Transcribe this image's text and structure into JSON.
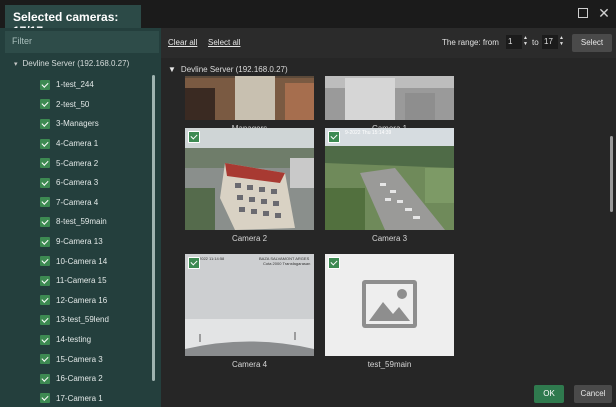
{
  "window": {
    "title": "Selected cameras: 17/17",
    "maximize_icon": "maximize-icon",
    "close_icon": "close-icon",
    "close_glyph": "✕"
  },
  "filter": {
    "placeholder": "Filter"
  },
  "tree": {
    "root_caret": "▾",
    "server_label": "Devline Server (192.168.0.27)",
    "cameras": [
      "1-test_244",
      "2-test_50",
      "3-Managers",
      "4-Camera 1",
      "5-Camera 2",
      "6-Camera 3",
      "7-Camera 4",
      "8-test_59main",
      "9-Camera 13",
      "10-Camera 14",
      "11-Camera 15",
      "12-Camera 16",
      "13-test_59lend",
      "14-testing",
      "15-Camera 3",
      "16-Camera 2",
      "17-Camera 1"
    ]
  },
  "toolbar": {
    "clear_all": "Clear all",
    "select_all": "Select all",
    "range_label": "The range: from",
    "range_from": "1",
    "to_label": "to",
    "range_to": "17",
    "select_button": "Select"
  },
  "grid": {
    "server_caret": "▼",
    "server_label": "Devline Server (192.168.0.27)",
    "tiles": [
      {
        "label": "Managers",
        "checked": false
      },
      {
        "label": "Camera 1",
        "checked": false
      },
      {
        "label": "Camera 2",
        "checked": true,
        "timestamp": ""
      },
      {
        "label": "Camera 3",
        "checked": true,
        "timestamp": "9-2022 Thu 15:14:39"
      },
      {
        "label": "Camera 4",
        "checked": true,
        "timestamp": ""
      },
      {
        "label": "test_59main",
        "checked": true,
        "placeholder_icon": "image-placeholder-icon"
      }
    ],
    "camera4_overlay": "BAZA SALVAMONT ARGES",
    "camera4_overlay2": "Cota 2000 Transfagarasan",
    "camera4_time": "2022 11:14:58"
  },
  "footer": {
    "ok": "OK",
    "cancel": "Cancel"
  },
  "colors": {
    "accent": "#3d8a52",
    "panel": "#243f3d",
    "ok": "#2f7a4e"
  }
}
